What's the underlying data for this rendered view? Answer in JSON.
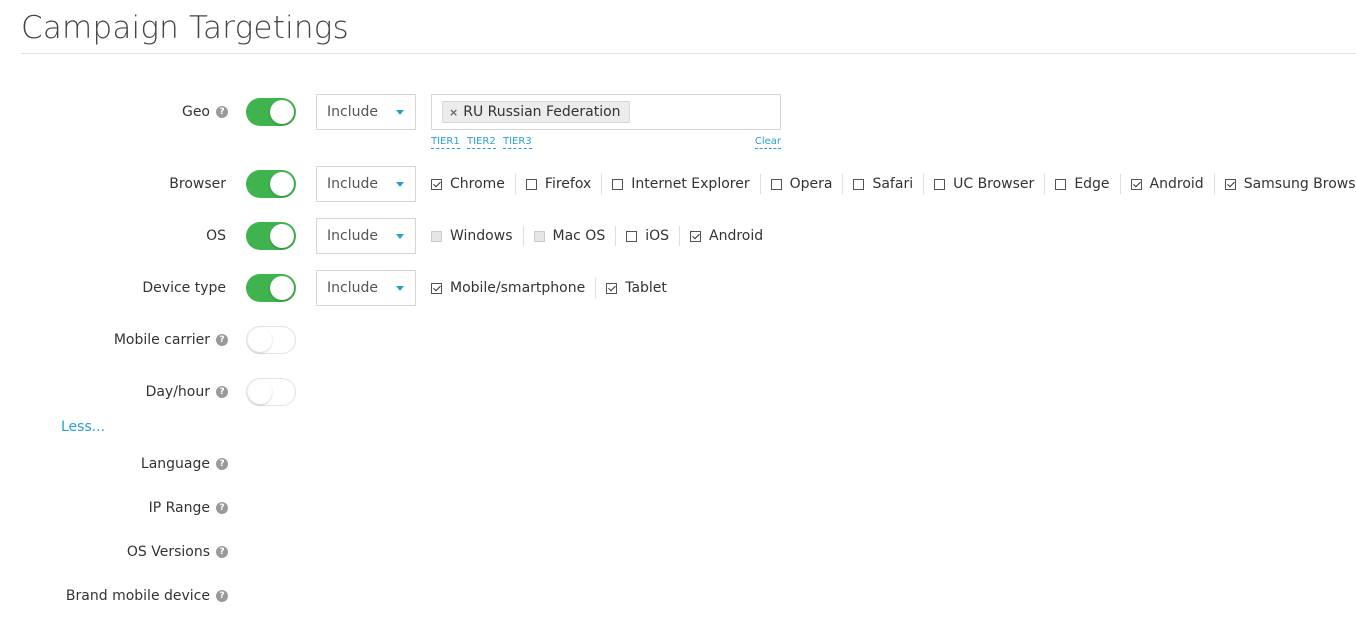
{
  "page": {
    "title": "Campaign Targetings"
  },
  "colors": {
    "toggle_on": "#3fb44e",
    "link": "#2a9fd6",
    "caret": "#2a9fd6"
  },
  "rows": {
    "geo": {
      "label": "Geo",
      "help_icon": "question-circle-icon",
      "toggle_on": true,
      "mode": "Include",
      "tags": [
        {
          "label": "RU Russian Federation"
        }
      ],
      "links": {
        "tier1": "TIER1",
        "tier2": "TIER2",
        "tier3": "TIER3",
        "clear": "Clear"
      }
    },
    "browser": {
      "label": "Browser",
      "toggle_on": true,
      "mode": "Include",
      "options": [
        {
          "label": "Chrome",
          "checked": true
        },
        {
          "label": "Firefox",
          "checked": false
        },
        {
          "label": "Internet Explorer",
          "checked": false
        },
        {
          "label": "Opera",
          "checked": false
        },
        {
          "label": "Safari",
          "checked": false
        },
        {
          "label": "UC Browser",
          "checked": false
        },
        {
          "label": "Edge",
          "checked": false
        },
        {
          "label": "Android",
          "checked": true
        },
        {
          "label": "Samsung Browser",
          "checked": true
        }
      ]
    },
    "os": {
      "label": "OS",
      "toggle_on": true,
      "mode": "Include",
      "options": [
        {
          "label": "Windows",
          "checked": false,
          "disabled": true
        },
        {
          "label": "Mac OS",
          "checked": false,
          "disabled": true
        },
        {
          "label": "iOS",
          "checked": false
        },
        {
          "label": "Android",
          "checked": true
        }
      ]
    },
    "device_type": {
      "label": "Device type",
      "toggle_on": true,
      "mode": "Include",
      "options": [
        {
          "label": "Mobile/smartphone",
          "checked": true
        },
        {
          "label": "Tablet",
          "checked": true
        }
      ]
    },
    "mobile_carrier": {
      "label": "Mobile carrier",
      "help_icon": "question-circle-icon",
      "toggle_on": false
    },
    "day_hour": {
      "label": "Day/hour",
      "help_icon": "question-circle-icon",
      "toggle_on": false
    }
  },
  "less_link": "Less...",
  "extra_rows": {
    "language": {
      "label": "Language",
      "help_icon": "question-circle-icon"
    },
    "ip_range": {
      "label": "IP Range",
      "help_icon": "question-circle-icon"
    },
    "os_versions": {
      "label": "OS Versions",
      "help_icon": "question-circle-icon"
    },
    "brand_mobile_device": {
      "label": "Brand mobile device",
      "help_icon": "question-circle-icon"
    }
  }
}
